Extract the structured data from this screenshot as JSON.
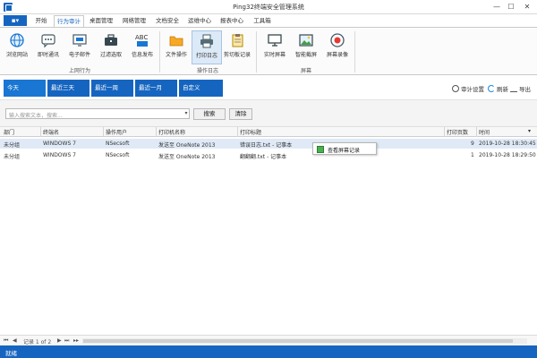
{
  "window": {
    "title": "Ping32终端安全管理系统",
    "minimize": "—",
    "maximize": "☐",
    "close": "✕"
  },
  "ribbon_tabs": {
    "file": "▪▾",
    "items": [
      "开始",
      "行为审计",
      "桌面管理",
      "网络管理",
      "文档安全",
      "运维中心",
      "报表中心",
      "工具箱"
    ],
    "active": "行为审计"
  },
  "ribbon": {
    "groups": [
      {
        "label": "上网行为",
        "buttons": [
          "浏览网站",
          "即时通讯",
          "电子邮件",
          "过滤选取",
          "信息发布"
        ]
      },
      {
        "label": "操作日志",
        "buttons": [
          "文件操作",
          "打印日志",
          "剪切板记录"
        ]
      },
      {
        "label": "屏幕",
        "buttons": [
          "实时屏幕",
          "智能截屏",
          "屏幕录像"
        ]
      }
    ],
    "selected": "打印日志"
  },
  "time_tabs": [
    "今天",
    "最近三天",
    "最近一周",
    "最近一月",
    "自定义"
  ],
  "tools": {
    "audit_settings": "审计设置",
    "refresh": "刷新",
    "export": "导出"
  },
  "search": {
    "placeholder": "输入搜索文本，搜索...",
    "search_btn": "搜索",
    "clear_btn": "清除"
  },
  "table": {
    "columns": [
      "部门",
      "终端名",
      "操作用户",
      "打印机名称",
      "打印标题",
      "打印页数",
      "时间"
    ],
    "rows": [
      [
        "未分组",
        "WINDOWS 7",
        "NSecsoft",
        "发送至 OneNote 2013",
        "错误日志.txt - 记事本",
        "9",
        "2019-10-28 18:30:45"
      ],
      [
        "未分组",
        "WINDOWS 7",
        "NSecsoft",
        "发送至 OneNote 2013",
        "翻翻翻.txt - 记事本",
        "1",
        "2019-10-28 18:29:50"
      ]
    ]
  },
  "context_menu": {
    "item": "查看屏幕记录"
  },
  "pager": {
    "first": "⏮",
    "prev": "◀",
    "text": "记录 1 of 2",
    "next": "▶",
    "last": "⏭",
    "more": "▸▸"
  },
  "status": {
    "text": "就绪"
  },
  "colors": {
    "accent": "#1565c0",
    "selection": "#dfeaf6"
  }
}
